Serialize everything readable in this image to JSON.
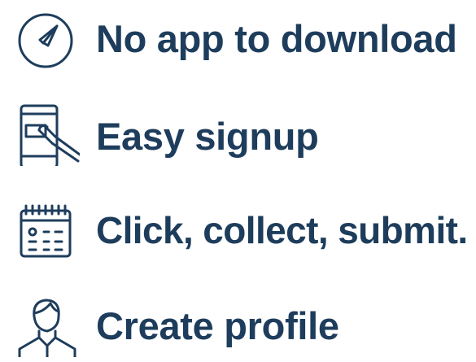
{
  "features": [
    {
      "label": "No app to download",
      "icon": "compass-icon"
    },
    {
      "label": "Easy signup",
      "icon": "phone-tap-icon"
    },
    {
      "label": "Click, collect, submit.",
      "icon": "calendar-icon"
    },
    {
      "label": "Create profile",
      "icon": "user-profile-icon"
    }
  ],
  "colors": {
    "text": "#1e3d5c",
    "icon_stroke": "#1e3d5c"
  }
}
